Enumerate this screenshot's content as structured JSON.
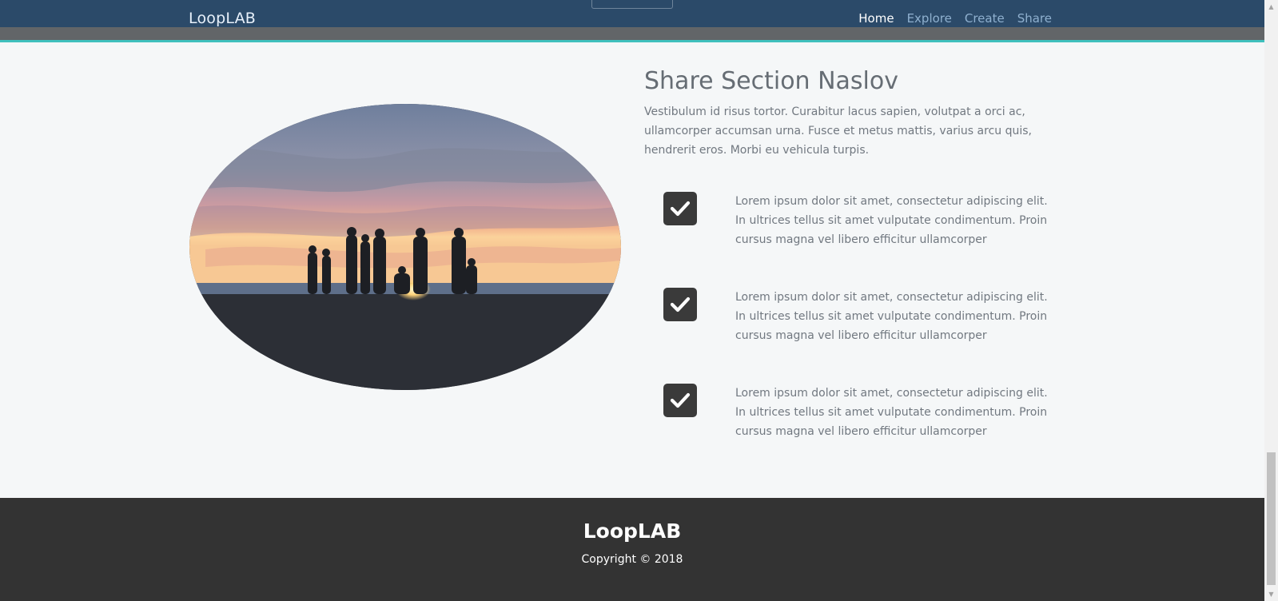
{
  "header": {
    "brand": "LoopLAB",
    "nav": [
      {
        "label": "Home",
        "active": true
      },
      {
        "label": "Explore",
        "active": false
      },
      {
        "label": "Create",
        "active": false
      },
      {
        "label": "Share",
        "active": false
      }
    ]
  },
  "share_section": {
    "title": "Share Section Naslov",
    "intro": "Vestibulum id risus tortor. Curabitur lacus sapien, volutpat a orci ac, ullamcorper accumsan urna. Fusce et metus mattis, varius arcu quis, hendrerit eros. Morbi eu vehicula turpis.",
    "features": [
      {
        "icon": "check-square-icon",
        "text": "Lorem ipsum dolor sit amet, consectetur adipiscing elit. In ultrices tellus sit amet vulputate condimentum. Proin cursus magna vel libero efficitur ullamcorper"
      },
      {
        "icon": "check-square-icon",
        "text": "Lorem ipsum dolor sit amet, consectetur adipiscing elit. In ultrices tellus sit amet vulputate condimentum. Proin cursus magna vel libero efficitur ullamcorper"
      },
      {
        "icon": "check-square-icon",
        "text": "Lorem ipsum dolor sit amet, consectetur adipiscing elit. In ultrices tellus sit amet vulputate condimentum. Proin cursus magna vel libero efficitur ullamcorper"
      }
    ]
  },
  "footer": {
    "brand": "LoopLAB",
    "copyright": "Copyright © 2018"
  },
  "colors": {
    "navbar": "#2b4a69",
    "accent_line": "#3fc0bd",
    "footer": "#333333",
    "checkbox": "#3a3a3a"
  }
}
